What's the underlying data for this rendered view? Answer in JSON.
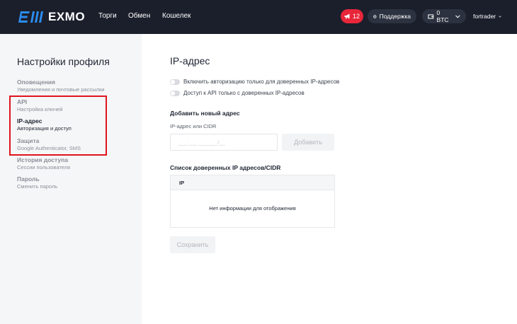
{
  "header": {
    "brand": "EXMO",
    "nav": [
      "Торги",
      "Обмен",
      "Кошелек"
    ],
    "notifications_count": "12",
    "support_label": "Поддержка",
    "wallet_label": "0 BTC",
    "username": "fortrader",
    "accent_color": "#e8263a"
  },
  "sidebar": {
    "title": "Настройки профиля",
    "items": [
      {
        "title": "Оповещения",
        "subtitle": "Уведомления и почтовые рассылки"
      },
      {
        "title": "API",
        "subtitle": "Настройка ключей"
      },
      {
        "title": "IP-адрес",
        "subtitle": "Авторизация и доступ"
      },
      {
        "title": "Защита",
        "subtitle": "Google Authenticator, SMS"
      },
      {
        "title": "История доступа",
        "subtitle": "Сессии пользователя"
      },
      {
        "title": "Пароль",
        "subtitle": "Сменить пароль"
      }
    ]
  },
  "main": {
    "title": "IP-адрес",
    "toggles": [
      "Включить авторизацию только для доверенных IP-адресов",
      "Доступ к API только с доверенных IP-адресов"
    ],
    "add_section_title": "Добавить новый адрес",
    "field_label": "IP-адрес или CIDR",
    "input_placeholder": "___.___.___.___/__",
    "add_button": "Добавить",
    "list_title": "Список доверенных IP адресов/CIDR",
    "table_header": "IP",
    "empty_text": "Нет информации для отображения",
    "save_button": "Сохранить"
  }
}
